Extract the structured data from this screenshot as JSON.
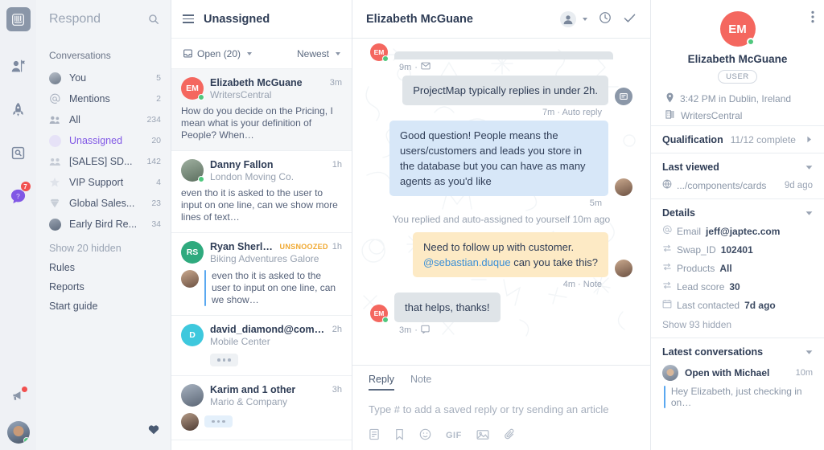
{
  "rail": {
    "logo_icon": "intercom-logo-icon",
    "items": [
      {
        "name": "respond",
        "icon": "person-flag-icon"
      },
      {
        "name": "engage",
        "icon": "rocket-icon"
      },
      {
        "name": "educate",
        "icon": "article-search-icon"
      },
      {
        "name": "messenger",
        "icon": "speech-bubble-icon",
        "badge": "7"
      }
    ],
    "announce_icon": "megaphone-icon",
    "user_avatar": "user-avatar"
  },
  "nav": {
    "title": "Respond",
    "search_icon": "search-icon",
    "section_label": "Conversations",
    "items": [
      {
        "label": "You",
        "count": "5",
        "icon": "avatar-icon",
        "active": false
      },
      {
        "label": "Mentions",
        "count": "2",
        "icon": "at-icon",
        "active": false
      },
      {
        "label": "All",
        "count": "234",
        "icon": "people-icon",
        "active": false
      },
      {
        "label": "Unassigned",
        "count": "20",
        "icon": "avatar-icon",
        "active": true
      },
      {
        "label": "[SALES] SD...",
        "count": "142",
        "icon": "team-icon",
        "active": false
      },
      {
        "label": "VIP Support",
        "count": "4",
        "icon": "star-icon",
        "active": false
      },
      {
        "label": "Global Sales...",
        "count": "23",
        "icon": "diamond-icon",
        "active": false
      },
      {
        "label": "Early Bird Re...",
        "count": "34",
        "icon": "avatar-icon",
        "active": false
      }
    ],
    "show_hidden": "Show 20 hidden",
    "links": [
      "Rules",
      "Reports",
      "Start guide"
    ],
    "heart_icon": "heart-icon"
  },
  "list": {
    "menu_icon": "hamburger-icon",
    "title": "Unassigned",
    "filter_status": "Open (20)",
    "filter_status_icon": "inbox-icon",
    "sort": "Newest",
    "conversations": [
      {
        "initials": "EM",
        "color": "#f4675f",
        "online": true,
        "name": "Elizabeth McGuane",
        "time": "3m",
        "tag": "",
        "company": "WritersCentral",
        "preview": "How do you decide on the Pricing, I mean what is your definition of People? When…",
        "selected": true,
        "type": "text"
      },
      {
        "initials": "",
        "color": "#8fa87c",
        "online": true,
        "photo": "man",
        "name": "Danny Fallon",
        "time": "1h",
        "tag": "",
        "company": "London Moving Co.",
        "preview": "even tho it is asked to the user to input on one line, can we show more lines of text…",
        "selected": false,
        "type": "text"
      },
      {
        "initials": "RS",
        "color": "#2faa7e",
        "online": false,
        "name": "Ryan Sherlock",
        "time": "1h",
        "tag": "UNSNOOZED",
        "company": "Biking Adventures Galore",
        "preview": "even tho it is asked to the user to input on one line, can we show…",
        "selected": false,
        "type": "reply"
      },
      {
        "initials": "D",
        "color": "#3ec8dd",
        "online": false,
        "name": "david_diamond@comp…",
        "time": "2h",
        "tag": "",
        "company": "Mobile Center",
        "preview": "",
        "selected": false,
        "type": "typing"
      },
      {
        "initials": "",
        "color": "#9aa8bb",
        "online": false,
        "photo": "man2",
        "name": "Karim and 1 other",
        "time": "3h",
        "tag": "",
        "company": "Mario & Company",
        "preview": "",
        "selected": false,
        "type": "typing-blue"
      }
    ]
  },
  "main": {
    "title": "Elizabeth McGuane",
    "assignee_icon": "assignee-avatar-icon",
    "snooze_icon": "clock-icon",
    "close_icon": "check-icon",
    "messages": [
      {
        "side": "left",
        "style": "grey",
        "text": "",
        "stamp": "9m",
        "stamp_icon": "email-icon",
        "cut": true,
        "avatar": "EM"
      },
      {
        "side": "right",
        "style": "grey",
        "text": "ProjectMap typically replies in under 2h.",
        "stamp": "7m · Auto reply",
        "avatar": "bot"
      },
      {
        "side": "right",
        "style": "blue",
        "text": "Good question! People means the users/customers and leads you store in the database but you can have as many agents as you'd like",
        "stamp": "5m",
        "avatar": "agent"
      },
      {
        "side": "system",
        "text": "You replied and auto-assigned to yourself 10m ago"
      },
      {
        "side": "right",
        "style": "amber",
        "text": "Need to follow up with customer. @sebastian.duque can you take this?",
        "mention": "@sebastian.duque",
        "stamp": "4m ·  Note",
        "avatar": "agent"
      },
      {
        "side": "left",
        "style": "grey",
        "text": "that helps, thanks!",
        "stamp": "3m",
        "stamp_icon": "messenger-icon",
        "avatar": "EM"
      }
    ],
    "composer": {
      "tabs": [
        {
          "label": "Reply",
          "active": true
        },
        {
          "label": "Note",
          "active": false
        }
      ],
      "placeholder": "Type # to add a saved reply or try sending an article",
      "icons": [
        "article-icon",
        "saved-reply-icon",
        "emoji-icon",
        "gif-icon",
        "image-icon",
        "attachment-icon"
      ],
      "gif_label": "GIF"
    }
  },
  "right": {
    "kebab_icon": "more-options-icon",
    "initials": "EM",
    "avatar_color": "#f4675f",
    "name": "Elizabeth McGuane",
    "pill": "USER",
    "location": "3:42 PM in Dublin, Ireland",
    "location_icon": "pin-icon",
    "company": "WritersCentral",
    "company_icon": "building-icon",
    "qualification": {
      "label": "Qualification",
      "value": "11/12 complete",
      "arrow": "chevron-right-icon"
    },
    "last_viewed": {
      "label": "Last viewed",
      "page": ".../components/cards",
      "page_icon": "globe-icon",
      "ago": "9d ago"
    },
    "details": {
      "label": "Details",
      "rows": [
        {
          "icon": "at-icon",
          "label": "Email",
          "value": "jeff@japtec.com"
        },
        {
          "icon": "attribute-icon",
          "label": "Swap_ID",
          "value": "102401"
        },
        {
          "icon": "attribute-icon",
          "label": "Products",
          "value": "All"
        },
        {
          "icon": "attribute-icon",
          "label": "Lead score",
          "value": "30"
        },
        {
          "icon": "calendar-icon",
          "label": "Last contacted",
          "value": "7d ago"
        }
      ],
      "show_hidden": "Show 93 hidden"
    },
    "latest": {
      "label": "Latest conversations",
      "items": [
        {
          "title": "Open with Michael",
          "time": "10m",
          "preview": "Hey Elizabeth, just checking in on…"
        }
      ]
    }
  }
}
